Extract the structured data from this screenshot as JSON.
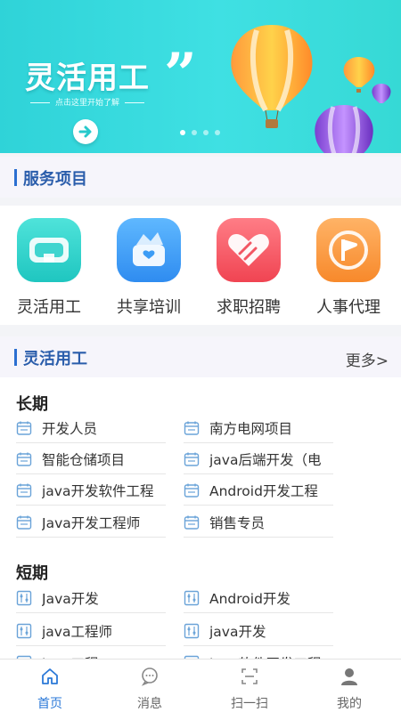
{
  "banner": {
    "title": "灵活用工",
    "subtitle": "点击这里开始了解",
    "quote_mark": "”",
    "dots": 4,
    "active_dot": 1
  },
  "services_section": {
    "title": "服务项目"
  },
  "services": [
    {
      "label": "灵活用工",
      "icon": "vr-goggles-icon",
      "color_top": "#4fe3da",
      "color_bottom": "#1fc6c0"
    },
    {
      "label": "共享培训",
      "icon": "gift-box-icon",
      "color_top": "#5fb8ff",
      "color_bottom": "#2f8cf0"
    },
    {
      "label": "求职招聘",
      "icon": "heart-hand-icon",
      "color_top": "#ff7d86",
      "color_bottom": "#f04452"
    },
    {
      "label": "人事代理",
      "icon": "flag-badge-icon",
      "color_top": "#ffb366",
      "color_bottom": "#f7892b"
    }
  ],
  "jobs_section": {
    "title": "灵活用工",
    "more": "更多>"
  },
  "long_term": {
    "title": "长期",
    "items": [
      "开发人员",
      "南方电网项目",
      "智能仓储项目",
      "java后端开发（电",
      "java开发软件工程",
      "Android开发工程",
      "Java开发工程师",
      "销售专员"
    ]
  },
  "short_term": {
    "title": "短期",
    "items": [
      "Java开发",
      "Android开发",
      "java工程师",
      "java开发",
      "java工程",
      "java软件开发工程"
    ]
  },
  "tabbar": [
    {
      "label": "首页",
      "icon": "home-icon",
      "active": true
    },
    {
      "label": "消息",
      "icon": "message-icon",
      "active": false
    },
    {
      "label": "扫一扫",
      "icon": "scan-icon",
      "active": false
    },
    {
      "label": "我的",
      "icon": "user-icon",
      "active": false
    }
  ],
  "colors": {
    "accent": "#2b79d8",
    "section_title": "#2a5dab",
    "banner": "#36d9d5"
  }
}
